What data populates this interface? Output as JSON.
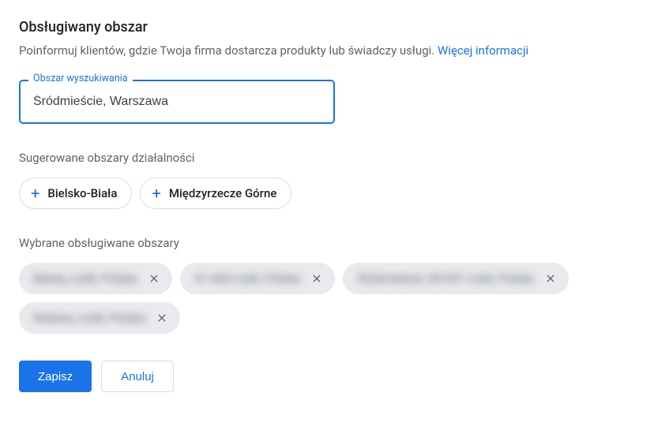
{
  "header": {
    "title": "Obsługiwany obszar",
    "subtitle_text": "Poinformuj klientów, gdzie Twoja firma dostarcza produkty lub świadczy usługi. ",
    "more_info_link": "Więcej informacji"
  },
  "search": {
    "label": "Obszar wyszukiwania",
    "value": "Śródmieście, Warszawa"
  },
  "suggested": {
    "label": "Sugerowane obszary działalności",
    "items": [
      {
        "label": "Bielsko-Biała"
      },
      {
        "label": "Międzyrzecze Górne"
      }
    ]
  },
  "selected": {
    "label": "Wybrane obsługiwane obszary",
    "items": [
      {
        "label": "Bałuty, Łódź, Polska"
      },
      {
        "label": "91-463 Łódź, Polska"
      },
      {
        "label": "Śródmieście, 90-001 Łódź, Polska"
      },
      {
        "label": "Widzew, Łódź, Polska"
      }
    ]
  },
  "actions": {
    "save": "Zapisz",
    "cancel": "Anuluj"
  },
  "colors": {
    "primary": "#1a73e8",
    "text": "#3c4043",
    "muted": "#5f6368",
    "chip_bg": "#e8eaed",
    "border": "#dadce0"
  }
}
